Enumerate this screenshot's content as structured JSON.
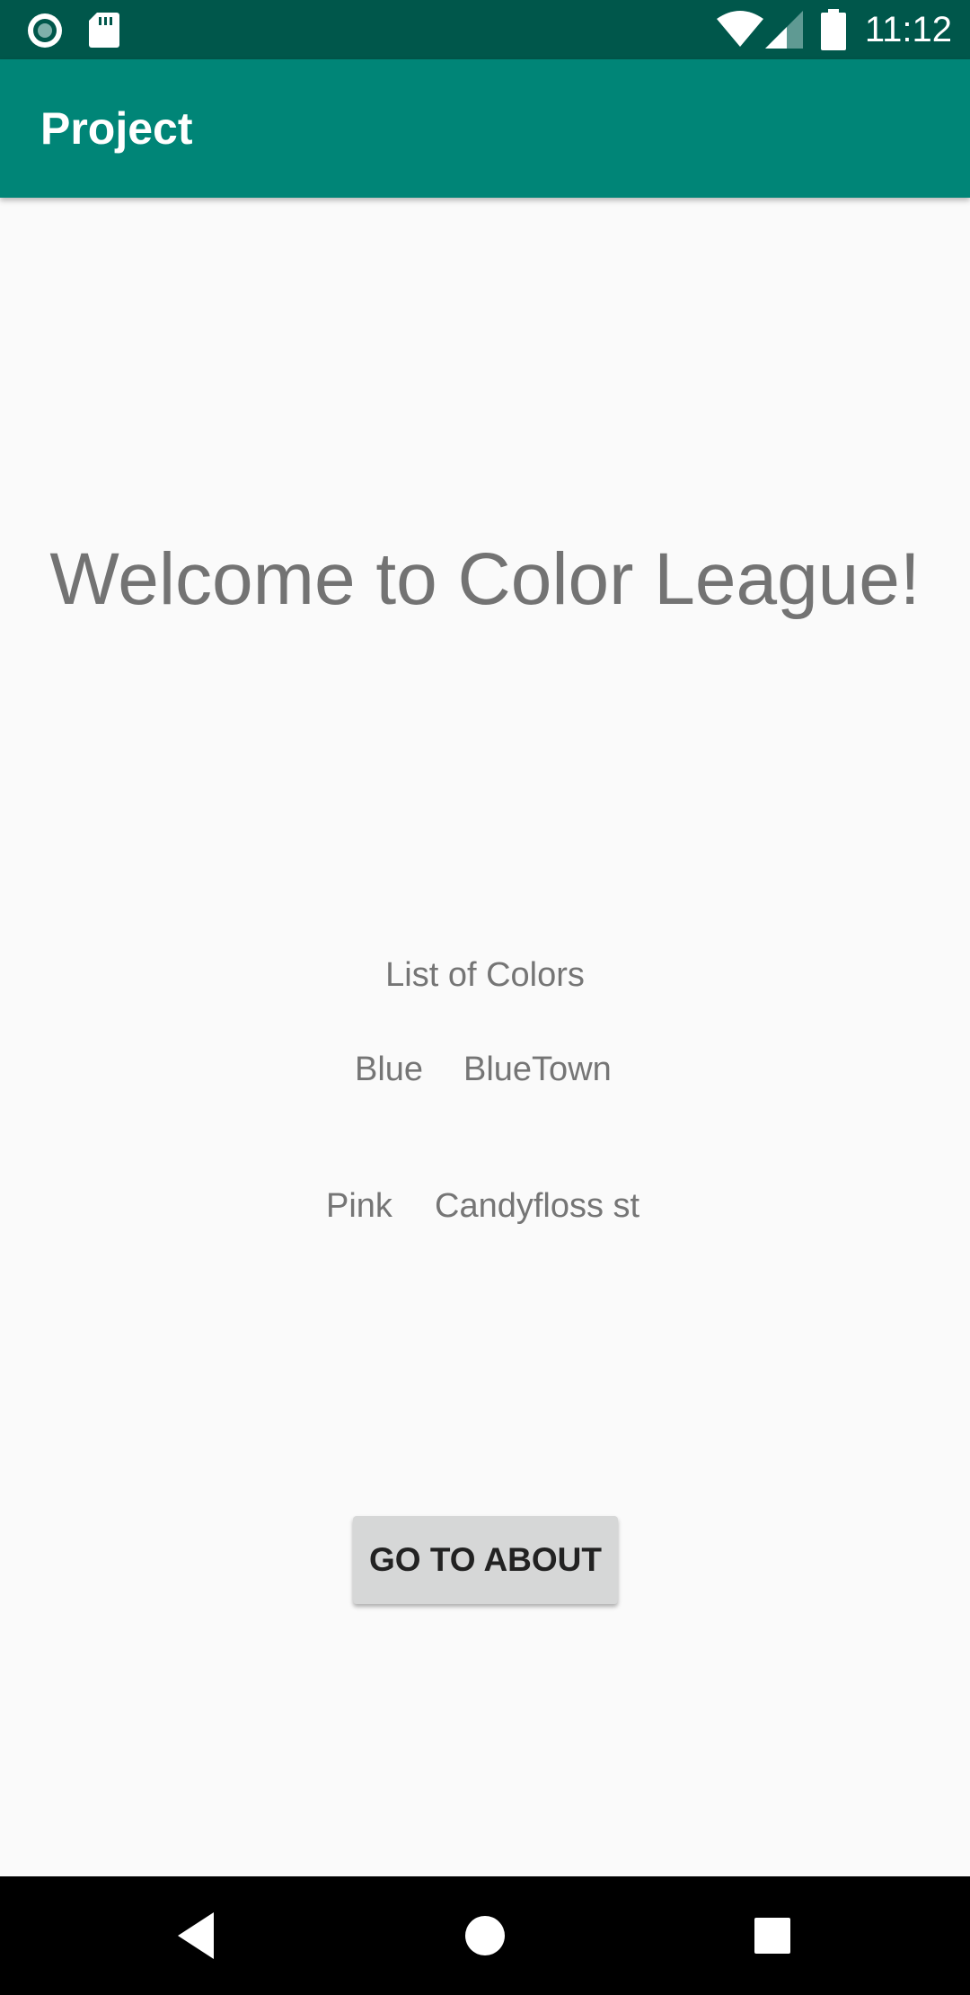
{
  "status_bar": {
    "time": "11:12",
    "icons": [
      "record-icon",
      "sd-card-icon",
      "wifi-icon",
      "cellular-signal-icon",
      "battery-icon"
    ]
  },
  "app_bar": {
    "title": "Project"
  },
  "main": {
    "welcome_text": "Welcome to Color League!",
    "list_title": "List of Colors",
    "colors": [
      {
        "name": "Blue",
        "place": "BlueTown"
      },
      {
        "name": "Pink",
        "place": "Candyfloss st"
      }
    ],
    "about_button_label": "GO TO ABOUT"
  },
  "nav_bar": {
    "icons": [
      "back-icon",
      "home-icon",
      "recents-icon"
    ]
  },
  "colors": {
    "status_bar": "#00574b",
    "app_bar": "#008577",
    "background": "#fafafa",
    "text": "#757575",
    "button": "#d6d7d7"
  }
}
